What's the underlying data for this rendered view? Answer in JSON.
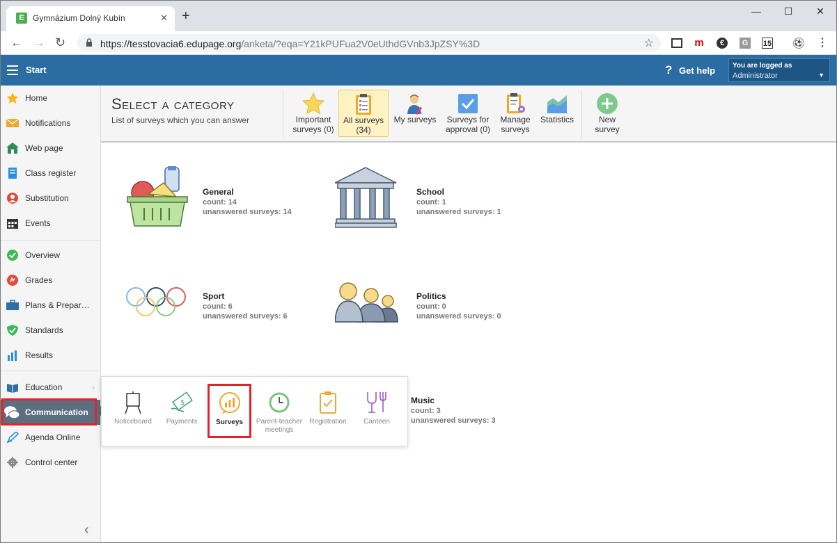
{
  "browser": {
    "tab_title": "Gymnázium Dolný Kubín",
    "tab_favicon": "E",
    "url_host": "https://tesstovacia6.edupage.org",
    "url_path": "/anketa/?eqa=Y21kPUFua2V0eUthdGVnb3JpZSY%3D",
    "extensions": [
      "m",
      "G",
      "15"
    ]
  },
  "header": {
    "start_label": "Start",
    "help_label": "Get help",
    "logged_label": "You are logged as",
    "user_name": "Administrator"
  },
  "sidebar": {
    "items": [
      {
        "label": "Home",
        "icon": "star-icon"
      },
      {
        "label": "Notifications",
        "icon": "envelope-icon"
      },
      {
        "label": "Web page",
        "icon": "house-icon"
      },
      {
        "label": "Class register",
        "icon": "book-icon"
      },
      {
        "label": "Substitution",
        "icon": "person-icon"
      },
      {
        "label": "Events",
        "icon": "calendar-icon"
      },
      {
        "label": "Overview",
        "icon": "check-circle-icon"
      },
      {
        "label": "Grades",
        "icon": "grade-circle-icon"
      },
      {
        "label": "Plans & Prepar…",
        "icon": "briefcase-icon"
      },
      {
        "label": "Standards",
        "icon": "shield-check-icon"
      },
      {
        "label": "Results",
        "icon": "bar-chart-icon"
      },
      {
        "label": "Education",
        "icon": "open-book-icon"
      },
      {
        "label": "Communication",
        "icon": "chat-bubbles-icon"
      },
      {
        "label": "Agenda Online",
        "icon": "pen-icon"
      },
      {
        "label": "Control center",
        "icon": "gear-icon"
      }
    ]
  },
  "page": {
    "title": "Select a category",
    "subtitle": "List of surveys which you can answer"
  },
  "toolbar": {
    "buttons": [
      {
        "line1": "Important",
        "line2": "surveys (0)"
      },
      {
        "line1": "All surveys",
        "line2": "(34)"
      },
      {
        "line1": "My surveys",
        "line2": ""
      },
      {
        "line1": "Surveys for",
        "line2": "approval (0)"
      },
      {
        "line1": "Manage",
        "line2": "surveys"
      },
      {
        "line1": "Statistics",
        "line2": ""
      },
      {
        "line1": "New",
        "line2": "survey"
      }
    ]
  },
  "categories": [
    {
      "name": "General",
      "count": "count: 14",
      "unanswered": "unanswered surveys: 14"
    },
    {
      "name": "School",
      "count": "count: 1",
      "unanswered": "unanswered surveys: 1"
    },
    {
      "name": "Sport",
      "count": "count: 6",
      "unanswered": "unanswered surveys: 6"
    },
    {
      "name": "Politics",
      "count": "count: 0",
      "unanswered": "unanswered surveys: 0"
    },
    {
      "name": "Music",
      "count": "count: 3",
      "unanswered": "unanswered surveys: 3"
    }
  ],
  "popup": {
    "items": [
      {
        "line1": "Noticeboard",
        "line2": ""
      },
      {
        "line1": "Payments",
        "line2": ""
      },
      {
        "line1": "Surveys",
        "line2": ""
      },
      {
        "line1": "Parent-teacher",
        "line2": "meetings"
      },
      {
        "line1": "Registration",
        "line2": ""
      },
      {
        "line1": "Canteen",
        "line2": ""
      }
    ]
  },
  "colors": {
    "app_header": "#2b6ca3",
    "active_sidebar": "#5b6f80",
    "highlight_red": "#e3222b",
    "active_toolbar": "#fff3c4"
  }
}
